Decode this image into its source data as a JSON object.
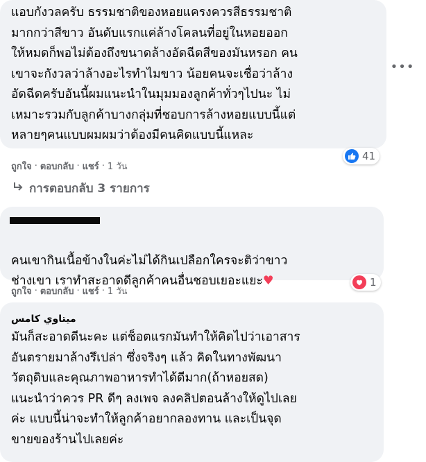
{
  "comments": [
    {
      "author": "",
      "text": "แอบกังวลครับ ธรรมชาติของหอยแครงควรสีธรรมชาติ\nมากกว่าสีขาว อันดับแรกแค่ล้างโคลนที่อยู่ในหอยออก\nให้หมดก็พอไม่ต้องถึงขนาดล้างอัดฉีดสีของมันหรอก คน\nเขาจะกังวลว่าล้างอะไรทำไมขาว น้อยคนจะเชื่อว่าล้าง\nอัดฉีดครับอันนี้ผมแนะนำในมุมมองลูกค้าทั่วๆไปนะ ไม่\nเหมาะรวมกับลูกค้าบางกลุ่มที่ชอบการล้างหอยแบบนี้แต่\nหลายๆคนแบบผมผมว่าต้องมีคนคิดแบบนี้แหละ",
      "reaction_count": "41",
      "reaction_icon": "like-icon",
      "like": "ถูกใจ",
      "reply": "ตอบกลับ",
      "share": "แชร์",
      "time": "1 วัน"
    },
    {
      "author": "",
      "text": "คนเขากินเนื้อข้างในค่ะไม่ได้กินเปลือกใครจะติว่าขาว\nช่างเขา เราทำสะอาดดีลูกค้าคนอื่นชอบเยอะแยะ",
      "reaction_count": "1",
      "reaction_icon": "love-icon",
      "like": "ถูกใจ",
      "reply": "ตอบกลับ",
      "share": "แชร์",
      "time": "1 วัน"
    },
    {
      "author": "ميتاوي كامس",
      "text": "มันก็สะอาดดีนะคะ แต่ช็อตแรกมันทำให้คิดไปว่าเอาสาร\nอันตรายมาล้างรึเปล่า ซึ่งจริงๆ แล้ว คิดในทางพัฒนา\nวัตถุดิบและคุณภาพอาหารทำได้ดีมาก(ถ้าหอยสด)\nแนะนำว่าควร PR ดีๆ ลงเพจ ลงคลิปตอนล้างให้ดูไปเลย\nค่ะ แบบนี้น่าจะทำให้ลูกค้าอยากลองทาน และเป็นจุด\nขายของร้านไปเลยค่ะ"
    }
  ],
  "replies_link": "การตอบกลับ 3 รายการ",
  "separator": "·",
  "more_icon": "more-options-icon",
  "colors": {
    "bubble": "#f0f2f5",
    "meta": "#65676b",
    "like_blue": "#1877f2",
    "love_red": "#f33e58"
  }
}
